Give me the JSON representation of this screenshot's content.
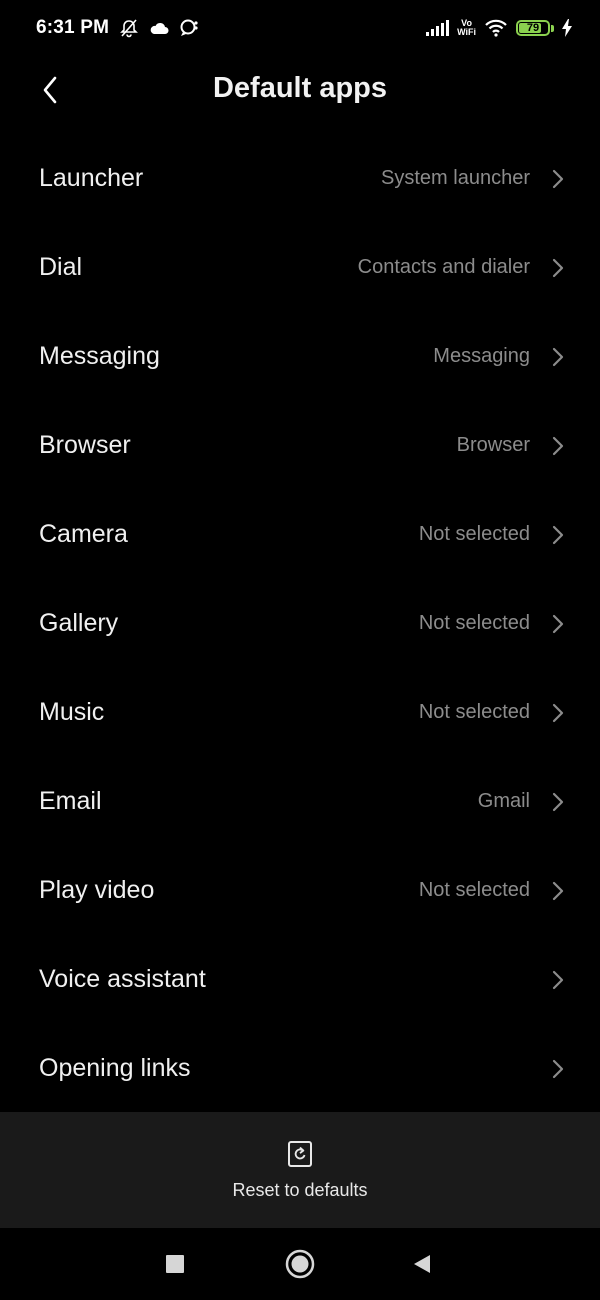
{
  "status_bar": {
    "time": "6:31 PM",
    "volte_top": "Vo",
    "volte_bottom": "WiFi",
    "battery_level": "79",
    "battery_fraction": 0.79,
    "battery_color": "#8bd14f"
  },
  "header": {
    "title": "Default apps"
  },
  "settings": [
    {
      "label": "Launcher",
      "value": "System launcher"
    },
    {
      "label": "Dial",
      "value": "Contacts and dialer"
    },
    {
      "label": "Messaging",
      "value": "Messaging"
    },
    {
      "label": "Browser",
      "value": "Browser"
    },
    {
      "label": "Camera",
      "value": "Not selected"
    },
    {
      "label": "Gallery",
      "value": "Not selected"
    },
    {
      "label": "Music",
      "value": "Not selected"
    },
    {
      "label": "Email",
      "value": "Gmail"
    },
    {
      "label": "Play video",
      "value": "Not selected"
    },
    {
      "label": "Voice assistant",
      "value": ""
    },
    {
      "label": "Opening links",
      "value": ""
    }
  ],
  "reset": {
    "label": "Reset to defaults"
  },
  "icons": {
    "back": "chevron-left-icon",
    "row_arrow": "chevron-right-icon",
    "reset": "reset-icon",
    "nav_recents": "square-icon",
    "nav_home": "circle-icon",
    "nav_back": "triangle-back-icon"
  },
  "colors": {
    "background": "#000000",
    "secondary_text": "#8c8c8c",
    "panel": "#1a1a1a"
  }
}
